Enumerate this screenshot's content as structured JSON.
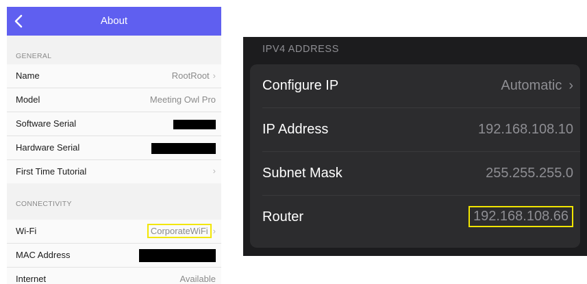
{
  "left": {
    "title": "About",
    "general": {
      "header": "GENERAL",
      "rows": [
        {
          "label": "Name",
          "value": "RootRoot"
        },
        {
          "label": "Model",
          "value": "Meeting Owl Pro"
        },
        {
          "label": "Software Serial"
        },
        {
          "label": "Hardware Serial"
        },
        {
          "label": "First Time Tutorial"
        }
      ]
    },
    "connectivity": {
      "header": "CONNECTIVITY",
      "rows": [
        {
          "label": "Wi-Fi",
          "value": "CorporateWiFi"
        },
        {
          "label": "MAC Address"
        },
        {
          "label": "Internet",
          "value": "Available"
        }
      ]
    },
    "colors": {
      "nav": "#5f5ff0",
      "highlight": "#f2e600"
    }
  },
  "right": {
    "header": "IPV4 ADDRESS",
    "rows": [
      {
        "label": "Configure IP",
        "value": "Automatic"
      },
      {
        "label": "IP Address",
        "value": "192.168.108.10"
      },
      {
        "label": "Subnet Mask",
        "value": "255.255.255.0"
      },
      {
        "label": "Router",
        "value": "192.168.108.66"
      }
    ],
    "colors": {
      "background": "#1c1c1e",
      "card": "#2c2c2e",
      "highlight": "#f2e600"
    }
  },
  "icons": {
    "back": "chevron-left-icon",
    "disclosure": "chevron-right-icon"
  }
}
